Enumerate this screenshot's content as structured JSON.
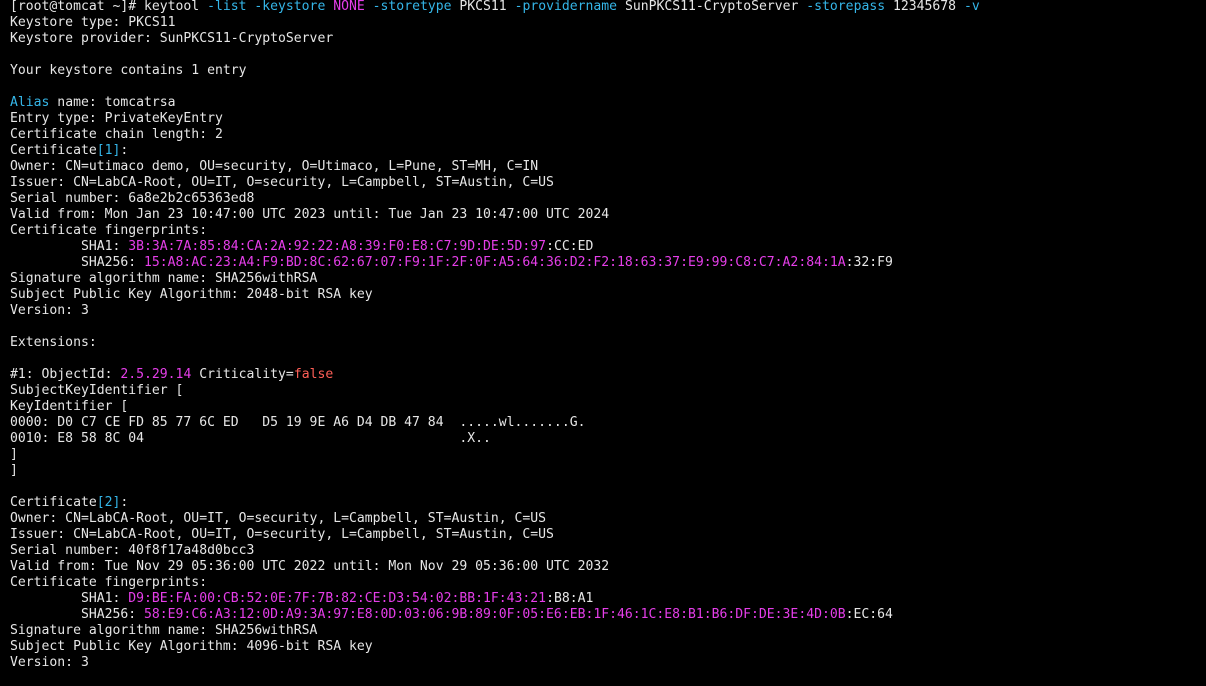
{
  "colors": {
    "background": "#000000",
    "text": "#e6e6e6",
    "cyan": "#35b6e8",
    "magenta": "#e53ee9",
    "red": "#ff5f57"
  },
  "terminal": {
    "lines": [
      [
        {
          "t": "[root@tomcat ~]# keytool "
        },
        {
          "t": "-list -keystore",
          "c": "cyan"
        },
        {
          "t": " "
        },
        {
          "t": "NONE",
          "c": "pink"
        },
        {
          "t": " "
        },
        {
          "t": "-storetype",
          "c": "cyan"
        },
        {
          "t": " PKCS11 "
        },
        {
          "t": "-providername",
          "c": "cyan"
        },
        {
          "t": " SunPKCS11-CryptoServer "
        },
        {
          "t": "-storepass",
          "c": "cyan"
        },
        {
          "t": " 12345678 "
        },
        {
          "t": "-v",
          "c": "cyan"
        }
      ],
      [
        {
          "t": "Keystore type: PKCS11"
        }
      ],
      [
        {
          "t": "Keystore provider: SunPKCS11-CryptoServer"
        }
      ],
      [],
      [
        {
          "t": "Your keystore contains 1 entry"
        }
      ],
      [],
      [
        {
          "t": "Alias",
          "c": "cyan"
        },
        {
          "t": " name: tomcatrsa"
        }
      ],
      [
        {
          "t": "Entry type: PrivateKeyEntry"
        }
      ],
      [
        {
          "t": "Certificate chain length: 2"
        }
      ],
      [
        {
          "t": "Certificate"
        },
        {
          "t": "[1]",
          "c": "cyan"
        },
        {
          "t": ":"
        }
      ],
      [
        {
          "t": "Owner: CN=utimaco demo, OU=security, O=Utimaco, L=Pune, ST=MH, C=IN"
        }
      ],
      [
        {
          "t": "Issuer: CN=LabCA-Root, OU=IT, O=security, L=Campbell, ST=Austin, C=US"
        }
      ],
      [
        {
          "t": "Serial number: 6a8e2b2c65363ed8"
        }
      ],
      [
        {
          "t": "Valid from: Mon Jan 23 10:47:00 UTC 2023 until: Tue Jan 23 10:47:00 UTC 2024"
        }
      ],
      [
        {
          "t": "Certificate fingerprints:"
        }
      ],
      [
        {
          "t": "         SHA1: "
        },
        {
          "t": "3B:3A:7A:85:84:CA:2A:92:22:A8:39:F0:E8:C7:9D:DE:5D:97",
          "c": "pink"
        },
        {
          "t": ":CC:ED"
        }
      ],
      [
        {
          "t": "         SHA256: "
        },
        {
          "t": "15:A8:AC:23:A4:F9:BD:8C:62:67:07:F9:1F:2F:0F:A5:64:36:D2:F2:18:63:37:E9:99:C8:C7:A2:84:1A",
          "c": "pink"
        },
        {
          "t": ":32:F9"
        }
      ],
      [
        {
          "t": "Signature algorithm name: SHA256withRSA"
        }
      ],
      [
        {
          "t": "Subject Public Key Algorithm: 2048-bit RSA key"
        }
      ],
      [
        {
          "t": "Version: 3"
        }
      ],
      [],
      [
        {
          "t": "Extensions:"
        }
      ],
      [],
      [
        {
          "t": "#1: ObjectId: "
        },
        {
          "t": "2.5.29.14",
          "c": "pink"
        },
        {
          "t": " Criticality="
        },
        {
          "t": "false",
          "c": "red"
        }
      ],
      [
        {
          "t": "SubjectKeyIdentifier ["
        }
      ],
      [
        {
          "t": "KeyIdentifier ["
        }
      ],
      [
        {
          "t": "0000: D0 C7 CE FD 85 77 6C ED   D5 19 9E A6 D4 DB 47 84  .....wl.......G."
        }
      ],
      [
        {
          "t": "0010: E8 58 8C 04                                        .X.."
        }
      ],
      [
        {
          "t": "]"
        }
      ],
      [
        {
          "t": "]"
        }
      ],
      [],
      [
        {
          "t": "Certificate"
        },
        {
          "t": "[2]",
          "c": "cyan"
        },
        {
          "t": ":"
        }
      ],
      [
        {
          "t": "Owner: CN=LabCA-Root, OU=IT, O=security, L=Campbell, ST=Austin, C=US"
        }
      ],
      [
        {
          "t": "Issuer: CN=LabCA-Root, OU=IT, O=security, L=Campbell, ST=Austin, C=US"
        }
      ],
      [
        {
          "t": "Serial number: 40f8f17a48d0bcc3"
        }
      ],
      [
        {
          "t": "Valid from: Tue Nov 29 05:36:00 UTC 2022 until: Mon Nov 29 05:36:00 UTC 2032"
        }
      ],
      [
        {
          "t": "Certificate fingerprints:"
        }
      ],
      [
        {
          "t": "         SHA1: "
        },
        {
          "t": "D9:BE:FA:00:CB:52:0E:7F:7B:82:CE:D3:54:02:BB:1F:43:21",
          "c": "pink"
        },
        {
          "t": ":B8:A1"
        }
      ],
      [
        {
          "t": "         SHA256: "
        },
        {
          "t": "58:E9:C6:A3:12:0D:A9:3A:97:E8:0D:03:06:9B:89:0F:05:E6:EB:1F:46:1C:E8:B1:B6:DF:DE:3E:4D:0B",
          "c": "pink"
        },
        {
          "t": ":EC:64"
        }
      ],
      [
        {
          "t": "Signature algorithm name: SHA256withRSA"
        }
      ],
      [
        {
          "t": "Subject Public Key Algorithm: 4096-bit RSA key"
        }
      ],
      [
        {
          "t": "Version: 3"
        }
      ]
    ]
  }
}
